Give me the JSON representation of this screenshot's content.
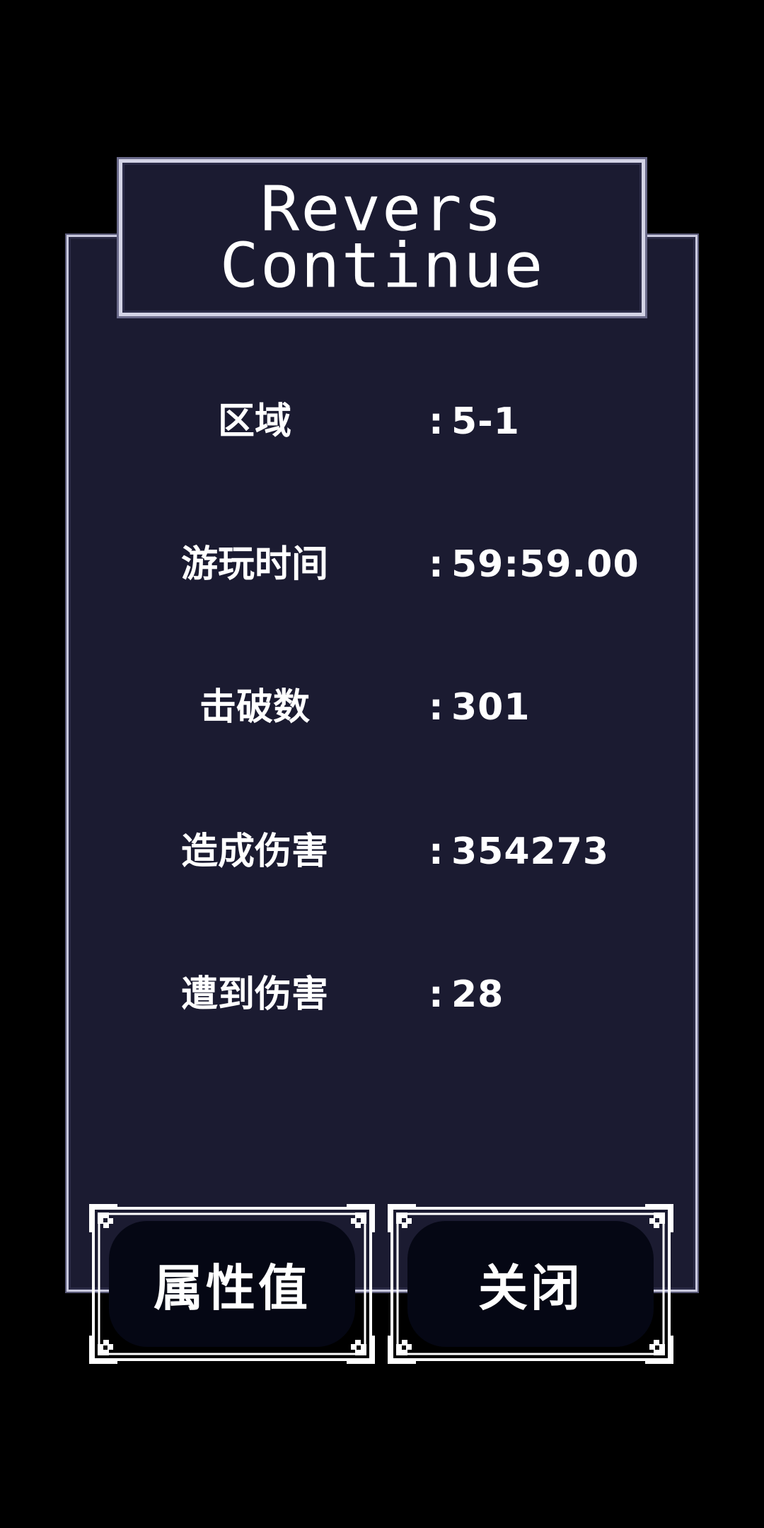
{
  "title": {
    "line1": "Revers",
    "line2": "Continue"
  },
  "stats": [
    {
      "label": "区域",
      "colon": ":",
      "value": "5-1"
    },
    {
      "label": "游玩时间",
      "colon": ":",
      "value": "59:59.00"
    },
    {
      "label": "击破数",
      "colon": ":",
      "value": "301"
    },
    {
      "label": "造成伤害",
      "colon": ":",
      "value": "354273"
    },
    {
      "label": "遭到伤害",
      "colon": ":",
      "value": "28"
    }
  ],
  "buttons": {
    "attributes_label": "属性值",
    "close_label": "关闭"
  },
  "colors": {
    "background": "#000000",
    "panel": "#1b1b31",
    "border": "#c9c9de",
    "button_fill": "#050714",
    "text": "#ffffff"
  }
}
